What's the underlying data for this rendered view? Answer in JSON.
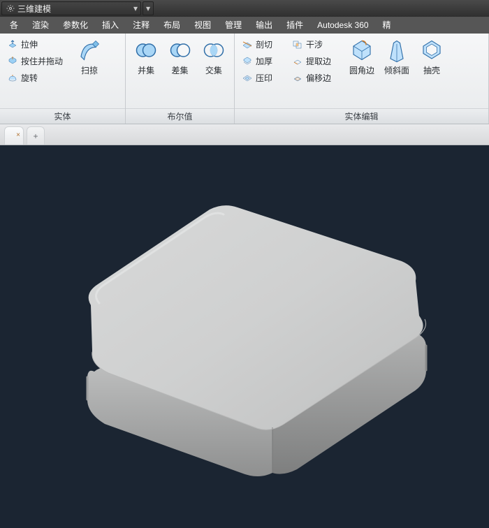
{
  "workspace": {
    "label": "三维建模"
  },
  "menu": {
    "items": [
      "各",
      "渲染",
      "参数化",
      "插入",
      "注释",
      "布局",
      "视图",
      "管理",
      "输出",
      "插件",
      "Autodesk 360",
      "精"
    ]
  },
  "ribbon": {
    "panels": [
      {
        "title": "实体",
        "small": [
          {
            "label": "拉伸",
            "icon": "extrude-icon"
          },
          {
            "label": "按住并拖动",
            "icon": "presspull-icon"
          },
          {
            "label": "旋转",
            "icon": "revolve-icon"
          }
        ],
        "big": [
          {
            "label": "扫掠",
            "icon": "sweep-icon"
          }
        ]
      },
      {
        "title": "布尔值",
        "big": [
          {
            "label": "并集",
            "icon": "union-icon"
          },
          {
            "label": "差集",
            "icon": "subtract-icon"
          },
          {
            "label": "交集",
            "icon": "intersect-icon"
          }
        ]
      },
      {
        "title": "实体编辑",
        "smallGroups": [
          [
            {
              "label": "剖切",
              "icon": "slice-icon"
            },
            {
              "label": "加厚",
              "icon": "thicken-icon"
            },
            {
              "label": "压印",
              "icon": "imprint-icon"
            }
          ],
          [
            {
              "label": "干涉",
              "icon": "interfere-icon"
            },
            {
              "label": "提取边",
              "icon": "extractedge-icon"
            },
            {
              "label": "偏移边",
              "icon": "offsetedge-icon"
            }
          ]
        ],
        "big": [
          {
            "label": "圆角边",
            "icon": "fillet-icon"
          },
          {
            "label": "倾斜面",
            "icon": "taper-icon"
          },
          {
            "label": "抽壳",
            "icon": "shell-icon"
          }
        ]
      }
    ]
  },
  "tabs": {
    "active_close": "×",
    "plus": "+"
  },
  "colors": {
    "accent": "#3b7fbf",
    "viewport": "#1b2532"
  }
}
